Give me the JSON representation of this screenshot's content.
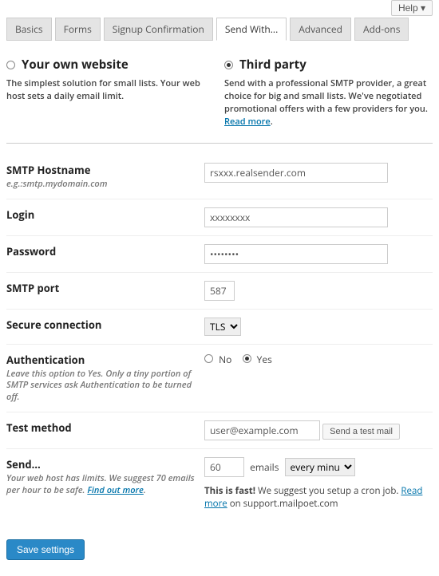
{
  "help_label": "Help ▾",
  "tabs": [
    "Basics",
    "Forms",
    "Signup Confirmation",
    "Send With...",
    "Advanced",
    "Add-ons"
  ],
  "active_tab": "Send With...",
  "methods": {
    "own": {
      "title": "Your own website",
      "desc": "The simplest solution for small lists. Your web host sets a daily email limit."
    },
    "third": {
      "title": "Third party",
      "desc_1": "Send with a professional SMTP provider, a great choice for big and small lists. We've negotiated promotional offers with a few providers for you. ",
      "read_more": "Read more",
      "desc_2": "."
    }
  },
  "fields": {
    "host_label": "SMTP Hostname",
    "host_hint": "e.g.:smtp.mydomain.com",
    "host_value": "rsxxx.realsender.com",
    "login_label": "Login",
    "login_value": "xxxxxxxx",
    "password_label": "Password",
    "password_value": "••••••••",
    "port_label": "SMTP port",
    "port_value": "587",
    "secure_label": "Secure connection",
    "secure_value": "TLS",
    "auth_label": "Authentication",
    "auth_hint": "Leave this option to Yes. Only a tiny portion of SMTP services ask Authentication to be turned off.",
    "auth_no": "No",
    "auth_yes": "Yes",
    "test_label": "Test method",
    "test_value": "user@example.com",
    "test_button": "Send a test mail",
    "send_label": "Send…",
    "send_hint_1": "Your web host has limits. We suggest 70 emails per hour to be safe. ",
    "send_hint_link": "Find out more",
    "send_hint_2": ".",
    "send_qty": "60",
    "send_emails_word": "emails",
    "send_interval": "every minute",
    "send_fast_1": "This is fast!",
    "send_fast_2": " We suggest you setup a cron job. ",
    "send_fast_link": "Read more",
    "send_fast_3": " on support.mailpoet.com"
  },
  "save_label": "Save settings"
}
